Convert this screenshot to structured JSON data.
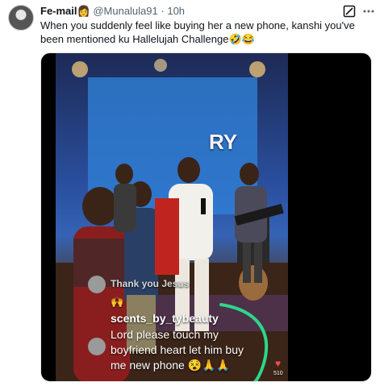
{
  "tweet": {
    "author_name": "Fe-mail",
    "author_emoji": "👩",
    "author_handle": "@Munalula91",
    "separator": "·",
    "time": "10h",
    "text": "When you suddenly feel like buying her a new phone, kanshi you've been mentioned ku Hallelujah Challenge🤣😂"
  },
  "video_overlay": {
    "comment1": "Thank you Jesus",
    "comment1_emoji": "🙌",
    "commenter": "scents_by_tybeauty",
    "comment2_line1": "Lord please touch my",
    "comment2_line2": "boyfriend heart let him buy",
    "comment2_line3": "me new phone 😵🙏🙏",
    "screen_text": "RY",
    "like_count": "510"
  },
  "colors": {
    "handle_gray": "#536471",
    "stage_blue": "#2a4f9e",
    "swipe_green": "#2dd68a"
  },
  "icons": {
    "grok": "grok-icon",
    "more": "more-options-icon"
  }
}
